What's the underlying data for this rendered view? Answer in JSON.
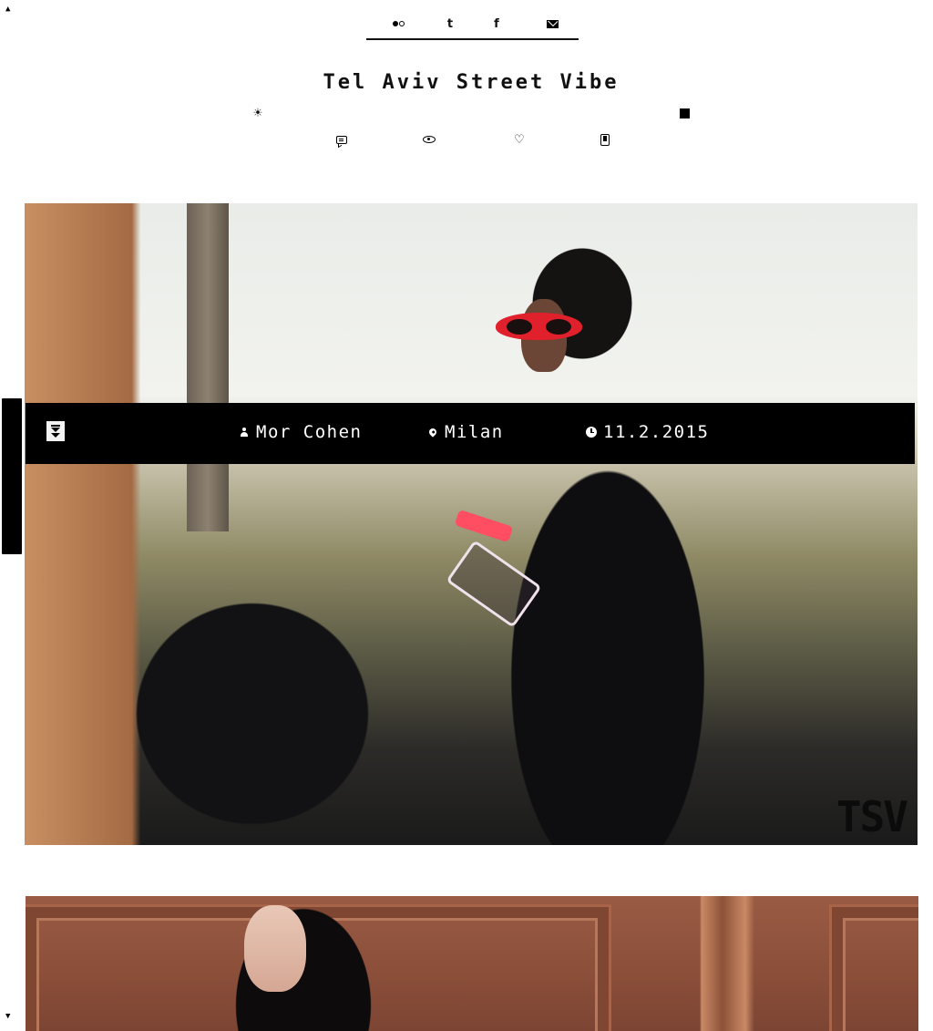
{
  "site": {
    "title": "Tel Aviv Street Vibe"
  },
  "social": [
    {
      "name": "flickr-icon"
    },
    {
      "name": "twitter-icon",
      "glyph": "t"
    },
    {
      "name": "facebook-icon",
      "glyph": "f"
    },
    {
      "name": "mail-icon"
    }
  ],
  "toolbar": {
    "sun_glyph": "☀",
    "heart_glyph": "♡"
  },
  "post": {
    "author": "Mor Cohen",
    "location": "Milan",
    "date": "11.2.2015",
    "watermark": "TSV"
  },
  "colors": {
    "page_bg": "#ffffff",
    "bar_bg": "#000000",
    "bar_text": "#ffffff"
  }
}
